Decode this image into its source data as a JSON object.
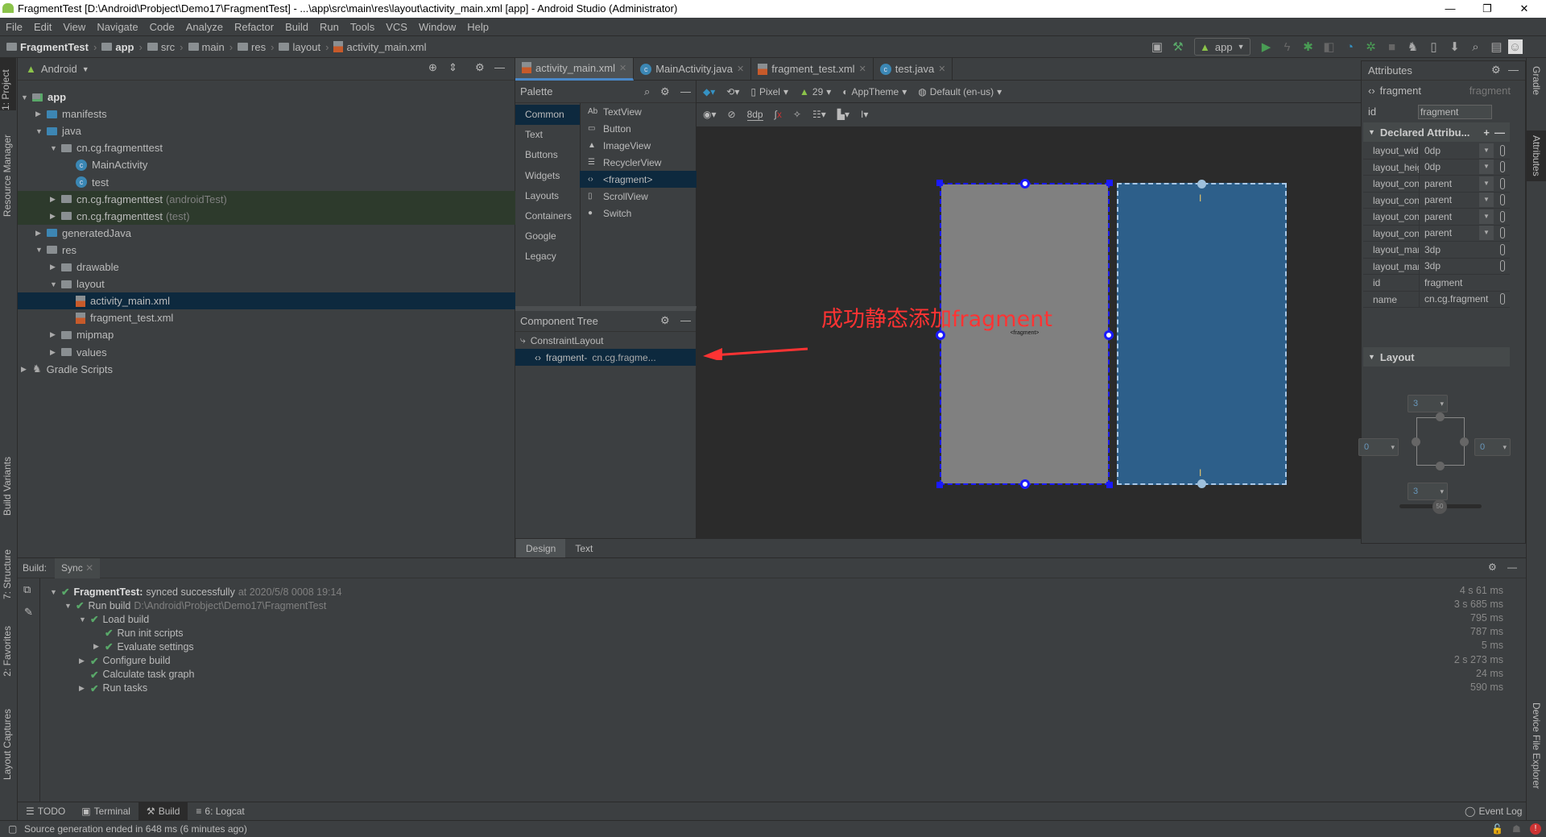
{
  "window": {
    "title": "FragmentTest [D:\\Android\\Probject\\Demo17\\FragmentTest] - ...\\app\\src\\main\\res\\layout\\activity_main.xml [app] - Android Studio (Administrator)",
    "min": "—",
    "max": "❐",
    "close": "✕"
  },
  "menu": [
    "File",
    "Edit",
    "View",
    "Navigate",
    "Code",
    "Analyze",
    "Refactor",
    "Build",
    "Run",
    "Tools",
    "VCS",
    "Window",
    "Help"
  ],
  "breadcrumb": [
    "FragmentTest",
    "app",
    "src",
    "main",
    "res",
    "layout",
    "activity_main.xml"
  ],
  "toolbar": {
    "run_config": "app"
  },
  "left_strip": {
    "project": "1: Project",
    "resource_manager": "Resource Manager",
    "build_variants": "Build Variants",
    "structure": "7: Structure",
    "favorites": "2: Favorites",
    "layout_captures": "Layout Captures"
  },
  "right_strip": {
    "gradle": "Gradle",
    "attributes": "Attributes",
    "device_file_explorer": "Device File Explorer"
  },
  "project": {
    "view": "Android",
    "tree": [
      {
        "label": "app",
        "level": 0,
        "arrow": "▼",
        "icon": "module",
        "bold": true
      },
      {
        "label": "manifests",
        "level": 1,
        "arrow": "▶",
        "icon": "folder-blue"
      },
      {
        "label": "java",
        "level": 1,
        "arrow": "▼",
        "icon": "folder-blue"
      },
      {
        "label": "cn.cg.fragmenttest",
        "level": 2,
        "arrow": "▼",
        "icon": "package"
      },
      {
        "label": "MainActivity",
        "level": 3,
        "arrow": "",
        "icon": "class"
      },
      {
        "label": "test",
        "level": 3,
        "arrow": "",
        "icon": "class"
      },
      {
        "label": "cn.cg.fragmenttest",
        "suffix": "(androidTest)",
        "level": 2,
        "arrow": "▶",
        "icon": "package",
        "test": true
      },
      {
        "label": "cn.cg.fragmenttest",
        "suffix": "(test)",
        "level": 2,
        "arrow": "▶",
        "icon": "package",
        "test": true
      },
      {
        "label": "generatedJava",
        "level": 1,
        "arrow": "▶",
        "icon": "folder-blue"
      },
      {
        "label": "res",
        "level": 1,
        "arrow": "▼",
        "icon": "folder"
      },
      {
        "label": "drawable",
        "level": 2,
        "arrow": "▶",
        "icon": "package"
      },
      {
        "label": "layout",
        "level": 2,
        "arrow": "▼",
        "icon": "package"
      },
      {
        "label": "activity_main.xml",
        "level": 3,
        "arrow": "",
        "icon": "xml",
        "selected": true
      },
      {
        "label": "fragment_test.xml",
        "level": 3,
        "arrow": "",
        "icon": "xml"
      },
      {
        "label": "mipmap",
        "level": 2,
        "arrow": "▶",
        "icon": "package"
      },
      {
        "label": "values",
        "level": 2,
        "arrow": "▶",
        "icon": "package"
      },
      {
        "label": "Gradle Scripts",
        "level": 0,
        "arrow": "▶",
        "icon": "gradle"
      }
    ]
  },
  "editor_tabs": [
    {
      "label": "activity_main.xml",
      "icon": "xml",
      "active": true
    },
    {
      "label": "MainActivity.java",
      "icon": "class"
    },
    {
      "label": "fragment_test.xml",
      "icon": "xml"
    },
    {
      "label": "test.java",
      "icon": "class"
    }
  ],
  "palette": {
    "title": "Palette",
    "categories": [
      "Common",
      "Text",
      "Buttons",
      "Widgets",
      "Layouts",
      "Containers",
      "Google",
      "Legacy"
    ],
    "selected_category": "Common",
    "items": [
      {
        "icon": "Ab",
        "label": "TextView"
      },
      {
        "icon": "▭",
        "label": "Button"
      },
      {
        "icon": "▲",
        "label": "ImageView"
      },
      {
        "icon": "☰",
        "label": "RecyclerView"
      },
      {
        "icon": "‹›",
        "label": "<fragment>"
      },
      {
        "icon": "▯",
        "label": "ScrollView"
      },
      {
        "icon": "●",
        "label": "Switch"
      }
    ],
    "selected_item": "<fragment>"
  },
  "component_tree": {
    "title": "Component Tree",
    "root": "ConstraintLayout",
    "child": "fragment-",
    "child_class": "cn.cg.fragme..."
  },
  "design_toolbar": {
    "device": "Pixel",
    "api": "29",
    "theme": "AppTheme",
    "locale": "Default (en-us)",
    "margin": "8dp"
  },
  "canvas": {
    "fragment_label": "<fragment>",
    "annotation": "成功静态添加fragment",
    "annotation_color": "#ff3333",
    "fragment_color": "#808080",
    "blueprint_color": "#2d5f8a"
  },
  "design_tabs": [
    "Design",
    "Text"
  ],
  "attributes": {
    "title": "Attributes",
    "component": "fragment",
    "component_type": "fragment",
    "id_label": "id",
    "id_value": "fragment",
    "declared_title": "Declared Attribu...",
    "declared": [
      {
        "key": "layout_widt",
        "value": "0dp",
        "dropdown": true
      },
      {
        "key": "layout_heig",
        "value": "0dp",
        "dropdown": true
      },
      {
        "key": "layout_con:",
        "value": "parent",
        "dropdown": true
      },
      {
        "key": "layout_con:",
        "value": "parent",
        "dropdown": true
      },
      {
        "key": "layout_con:",
        "value": "parent",
        "dropdown": true
      },
      {
        "key": "layout_con:",
        "value": "parent",
        "dropdown": true
      },
      {
        "key": "layout_mar",
        "value": "3dp"
      },
      {
        "key": "layout_mar",
        "value": "3dp"
      },
      {
        "key": "id",
        "value": "fragment",
        "nopin": true
      },
      {
        "key": "name",
        "value": "cn.cg.fragment"
      }
    ],
    "layout_title": "Layout",
    "margin_top": "3",
    "margin_bottom": "3",
    "margin_left": "0",
    "margin_right": "0",
    "bias": "50"
  },
  "build": {
    "label": "Build:",
    "tab": "Sync",
    "rows": [
      {
        "level": 0,
        "arrow": "▼",
        "bold": "FragmentTest:",
        "text": "synced successfully",
        "dim": "at 2020/5/8 0008 19:14",
        "time": "4 s 61 ms"
      },
      {
        "level": 1,
        "arrow": "▼",
        "text": "Run build",
        "dim": "D:\\Android\\Probject\\Demo17\\FragmentTest",
        "time": "3 s 685 ms"
      },
      {
        "level": 2,
        "arrow": "▼",
        "text": "Load build",
        "time": "795 ms"
      },
      {
        "level": 3,
        "arrow": "",
        "text": "Run init scripts",
        "time": "787 ms"
      },
      {
        "level": 3,
        "arrow": "▶",
        "text": "Evaluate settings",
        "time": "5 ms"
      },
      {
        "level": 2,
        "arrow": "▶",
        "text": "Configure build",
        "time": "2 s 273 ms"
      },
      {
        "level": 2,
        "arrow": "",
        "text": "Calculate task graph",
        "time": "24 ms"
      },
      {
        "level": 2,
        "arrow": "▶",
        "text": "Run tasks",
        "time": "590 ms"
      }
    ]
  },
  "tool_tabs": [
    {
      "label": "TODO",
      "icon": "☰"
    },
    {
      "label": "Terminal",
      "icon": "▣"
    },
    {
      "label": "Build",
      "icon": "⚒",
      "active": true
    },
    {
      "label": "6: Logcat",
      "icon": "≡"
    }
  ],
  "event_log": "Event Log",
  "status": "Source generation ended in 648 ms (6 minutes ago)"
}
